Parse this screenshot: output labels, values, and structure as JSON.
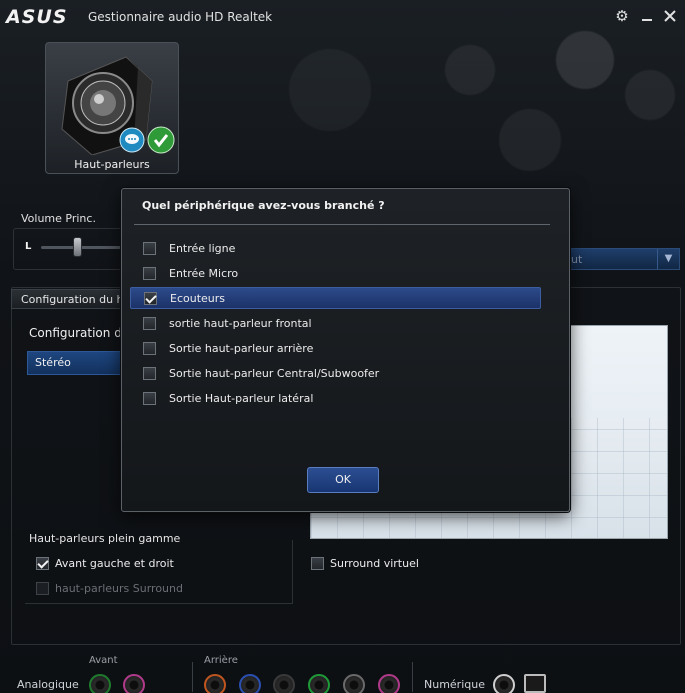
{
  "titlebar": {
    "logo": "ASUS",
    "title": "Gestionnaire audio HD Realtek"
  },
  "device": {
    "label": "Haut-parleurs",
    "icons": [
      "speaker-icon",
      "chat-bubble-icon",
      "check-icon"
    ]
  },
  "volume": {
    "label": "Volume Princ.",
    "left_letter": "L",
    "level": 0.5
  },
  "right_dropdown": {
    "text": "ut"
  },
  "config": {
    "tab_label": "Configuration du h",
    "sub_label": "Configuration du",
    "selected": "Stéréo"
  },
  "full_range": {
    "title": "Haut-parleurs plein gamme",
    "front": "Avant gauche et droit",
    "surround": "haut-parleurs Surround",
    "front_checked": true,
    "surround_checked": false
  },
  "virtual_surround": {
    "label": "Surround virtuel",
    "checked": false
  },
  "jacks": {
    "analog_label": "Analogique",
    "front_label": "Avant",
    "rear_label": "Arrière",
    "digital_label": "Numérique",
    "colors": {
      "green": "#1f7a2e",
      "pink": "#b03a8a",
      "orange": "#c0561f",
      "blue": "#2a4fb0",
      "black": "#3a3a3a",
      "grey": "#6a6a6a"
    }
  },
  "dialog": {
    "title": "Quel périphérique avez-vous branché ?",
    "options": [
      {
        "label": "Entrée ligne",
        "checked": false
      },
      {
        "label": "Entrée Micro",
        "checked": false
      },
      {
        "label": "Ecouteurs",
        "checked": true
      },
      {
        "label": "sortie haut-parleur frontal",
        "checked": false
      },
      {
        "label": "Sortie haut-parleur arrière",
        "checked": false
      },
      {
        "label": "Sortie haut-parleur Central/Subwoofer",
        "checked": false
      },
      {
        "label": "Sortie Haut-parleur latéral",
        "checked": false
      }
    ],
    "ok_label": "OK"
  }
}
